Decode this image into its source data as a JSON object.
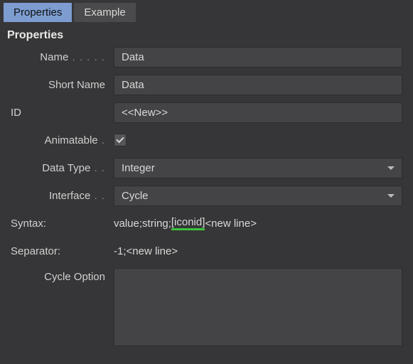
{
  "tabs": {
    "properties": "Properties",
    "example": "Example",
    "active": "properties"
  },
  "section_header": "Properties",
  "labels": {
    "name": "Name",
    "short_name": "Short Name",
    "id": "ID",
    "animatable": "Animatable",
    "data_type": "Data Type",
    "interface": "Interface",
    "syntax": "Syntax:",
    "separator": "Separator:",
    "cycle_option": "Cycle Option"
  },
  "values": {
    "name": "Data",
    "short_name": "Data",
    "id": "<<New>>",
    "animatable": true,
    "data_type": "Integer",
    "interface": "Cycle",
    "syntax_prefix": "value;string;",
    "syntax_highlight": "[iconid]",
    "syntax_suffix": "<new line>",
    "separator": "-1;<new line>",
    "cycle_option": ""
  }
}
